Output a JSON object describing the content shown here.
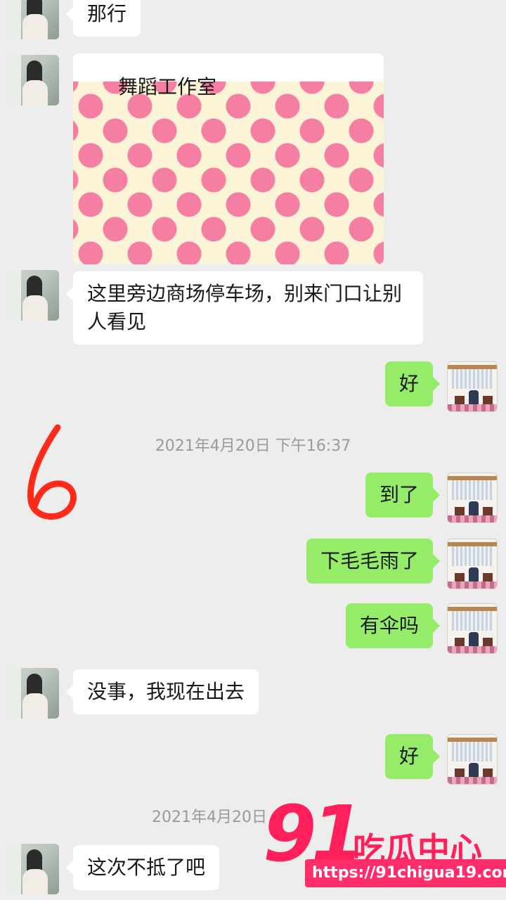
{
  "messages": {
    "m1": "那行",
    "card_title": "舞蹈工作室",
    "m3": "这里旁边商场停车场，别来门口让别人看见",
    "m4": "好",
    "m5": "到了",
    "m6": "下毛毛雨了",
    "m7": "有伞吗",
    "m8": "没事，我现在出去",
    "m9": "好",
    "m10": "这次不抵了吧"
  },
  "timestamps": {
    "t1": "2021年4月20日 下午16:37",
    "t2": "2021年4月20日"
  },
  "annotation": {
    "number": "6",
    "color": "#ff2a1a"
  },
  "watermark": {
    "number": "91",
    "text": "吃瓜中心",
    "url": "https://91chigua19.com"
  },
  "colors": {
    "background": "#ededed",
    "incoming_bubble": "#ffffff",
    "outgoing_bubble": "#95ec69"
  }
}
